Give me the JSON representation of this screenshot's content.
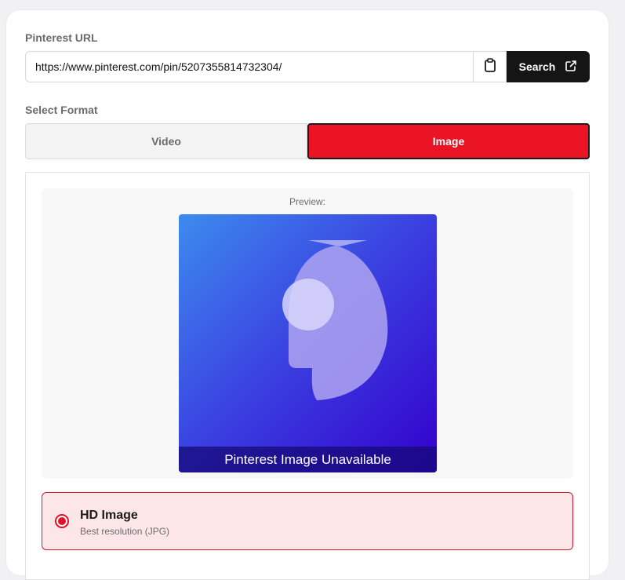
{
  "url_section": {
    "label": "Pinterest URL",
    "input_value": "https://www.pinterest.com/pin/5207355814732304/",
    "paste_icon": "clipboard-icon",
    "search_label": "Search",
    "search_icon": "external-link-icon"
  },
  "format_section": {
    "label": "Select Format",
    "tabs": [
      {
        "label": "Video",
        "selected": false
      },
      {
        "label": "Image",
        "selected": true
      }
    ]
  },
  "preview": {
    "label": "Preview:",
    "caption": "Pinterest Image Unavailable"
  },
  "options": [
    {
      "title": "HD Image",
      "subtitle": "Best resolution (JPG)",
      "selected": true
    }
  ],
  "colors": {
    "accent_red": "#eb1425",
    "search_button": "#151515",
    "option_bg": "#fde6e8"
  }
}
